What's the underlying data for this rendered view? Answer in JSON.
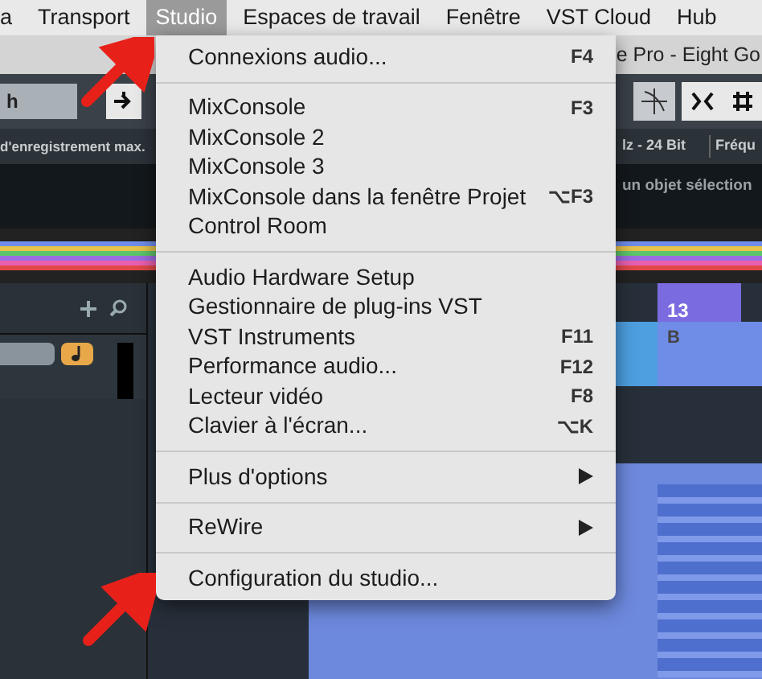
{
  "menu_bar": [
    {
      "label": "a",
      "selected": false
    },
    {
      "label": "Transport",
      "selected": false
    },
    {
      "label": "Studio",
      "selected": true
    },
    {
      "label": "Espaces de travail",
      "selected": false
    },
    {
      "label": "Fenêtre",
      "selected": false
    },
    {
      "label": "VST Cloud",
      "selected": false
    },
    {
      "label": "Hub",
      "selected": false
    }
  ],
  "window_title": "e Pro - Eight Go",
  "toolbar": {
    "dropdown_value": "h"
  },
  "status_bar": [
    "d'enregistrement max.",
    "lz - 24 Bit",
    "Fréqu"
  ],
  "info_line": "un objet sélection",
  "menu": [
    {
      "kind": "item",
      "label": "Connexions audio...",
      "shortcut": "F4"
    },
    {
      "kind": "separator"
    },
    {
      "kind": "item",
      "label": "MixConsole",
      "shortcut": "F3"
    },
    {
      "kind": "item",
      "label": "MixConsole 2"
    },
    {
      "kind": "item",
      "label": "MixConsole 3"
    },
    {
      "kind": "item",
      "label": "MixConsole dans la fenêtre Projet",
      "shortcut": "⌥F3"
    },
    {
      "kind": "item",
      "label": "Control Room"
    },
    {
      "kind": "separator"
    },
    {
      "kind": "item",
      "label": "Audio Hardware Setup"
    },
    {
      "kind": "item",
      "label": "Gestionnaire de plug-ins VST"
    },
    {
      "kind": "item",
      "label": "VST Instruments",
      "shortcut": "F11"
    },
    {
      "kind": "item",
      "label": "Performance audio...",
      "shortcut": "F12"
    },
    {
      "kind": "item",
      "label": "Lecteur vidéo",
      "shortcut": "F8"
    },
    {
      "kind": "item",
      "label": "Clavier à l'écran...",
      "shortcut": "⌥K"
    },
    {
      "kind": "separator"
    },
    {
      "kind": "submenu",
      "label": "Plus d'options"
    },
    {
      "kind": "separator"
    },
    {
      "kind": "submenu",
      "label": "ReWire"
    },
    {
      "kind": "separator"
    },
    {
      "kind": "item",
      "label": "Configuration du studio..."
    }
  ],
  "ruler": {
    "bar": "13"
  },
  "event": {
    "label": "B"
  }
}
